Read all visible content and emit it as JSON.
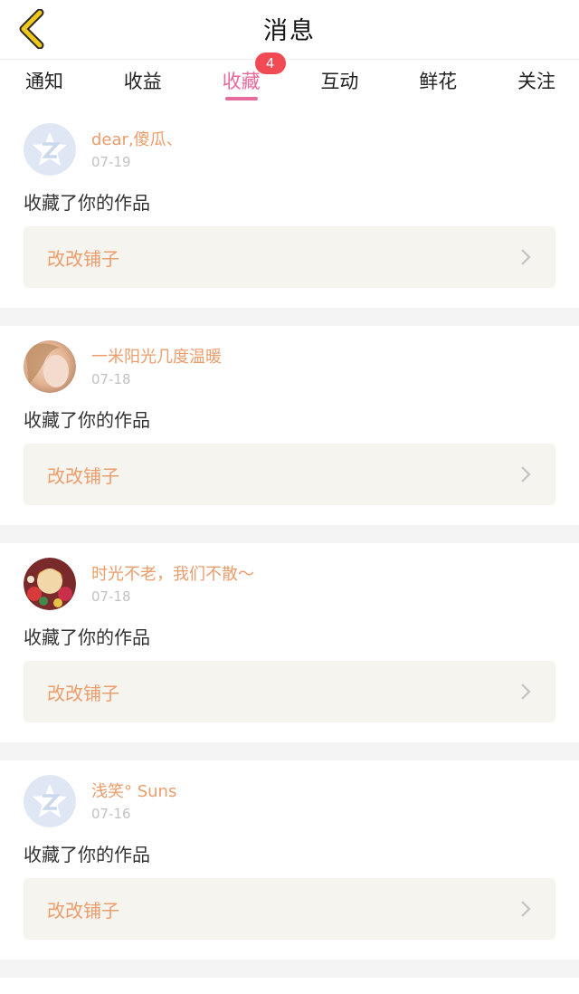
{
  "header": {
    "title": "消息",
    "back_icon": "chevron-left-icon",
    "back_color": "#f0c71a"
  },
  "tabs": [
    {
      "label": "通知"
    },
    {
      "label": "收益"
    },
    {
      "label": "收藏",
      "badge": "4",
      "active": true
    },
    {
      "label": "互动"
    },
    {
      "label": "鲜花"
    },
    {
      "label": "关注"
    }
  ],
  "notifications": [
    {
      "user": "dear,傻瓜、",
      "date": "07-19",
      "action": "收藏了你的作品",
      "store": "改改铺子",
      "avatar": "default-avatar"
    },
    {
      "user": "一米阳光几度温暖",
      "date": "07-18",
      "action": "收藏了你的作品",
      "store": "改改铺子",
      "avatar": "photo-avatar"
    },
    {
      "user": "时光不老，我们不散～",
      "date": "07-18",
      "action": "收藏了你的作品",
      "store": "改改铺子",
      "avatar": "illustration-avatar"
    },
    {
      "user": "浅笑° Suns",
      "date": "07-16",
      "action": "收藏了你的作品",
      "store": "改改铺子",
      "avatar": "default-avatar"
    }
  ],
  "colors": {
    "accent": "#e8699d",
    "badge": "#f24a55",
    "name": "#ec9d6c",
    "date": "#c2c2c2"
  }
}
